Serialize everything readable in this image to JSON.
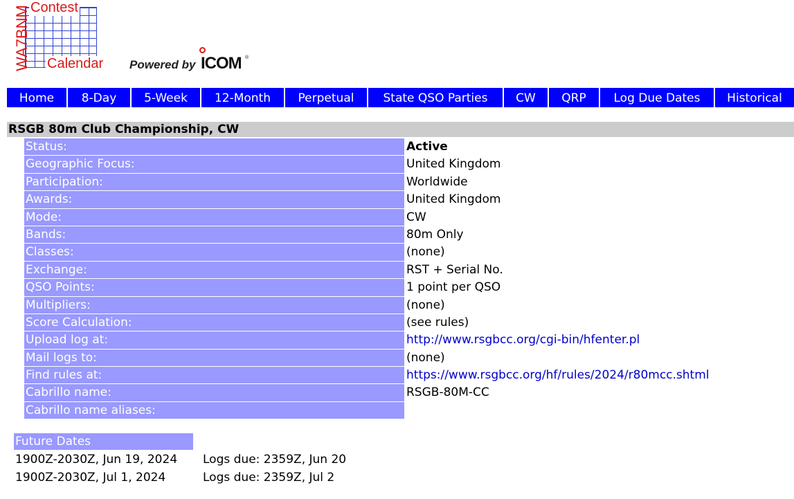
{
  "logo": {
    "vertical": "WA7BNM",
    "top": "Contest",
    "bottom": "Calendar",
    "powered_by": "Powered by",
    "brand": "ICOM",
    "tm": "®"
  },
  "nav": [
    "Home",
    "8-Day",
    "5-Week",
    "12-Month",
    "Perpetual",
    "State QSO Parties",
    "CW",
    "QRP",
    "Log Due Dates",
    "Historical"
  ],
  "contest": {
    "title": "RSGB 80m Club Championship, CW",
    "fields": [
      {
        "label": "Status:",
        "value": "Active"
      },
      {
        "label": "Geographic Focus:",
        "value": "United Kingdom"
      },
      {
        "label": "Participation:",
        "value": "Worldwide"
      },
      {
        "label": "Awards:",
        "value": "United Kingdom"
      },
      {
        "label": "Mode:",
        "value": "CW"
      },
      {
        "label": "Bands:",
        "value": "80m Only"
      },
      {
        "label": "Classes:",
        "value": "(none)"
      },
      {
        "label": "Exchange:",
        "value": "RST + Serial No."
      },
      {
        "label": "QSO Points:",
        "value": "1 point per QSO"
      },
      {
        "label": "Multipliers:",
        "value": "(none)"
      },
      {
        "label": "Score Calculation:",
        "value": "(see rules)"
      },
      {
        "label": "Upload log at:",
        "value": "http://www.rsgbcc.org/cgi-bin/hfenter.pl"
      },
      {
        "label": "Mail logs to:",
        "value": "(none)"
      },
      {
        "label": "Find rules at:",
        "value": "https://www.rsgbcc.org/hf/rules/2024/r80mcc.shtml"
      },
      {
        "label": "Cabrillo name:",
        "value": "RSGB-80M-CC"
      },
      {
        "label": "Cabrillo name aliases:",
        "value": ""
      }
    ]
  },
  "future": {
    "heading": "Future Dates",
    "rows": [
      {
        "date": "1900Z-2030Z, Jun 19, 2024",
        "due": "Logs due: 2359Z, Jun 20"
      },
      {
        "date": "1900Z-2030Z, Jul 1, 2024",
        "due": "Logs due: 2359Z, Jul 2"
      }
    ]
  },
  "colors": {
    "nav": "#0000ff",
    "label_bg": "#9999ff",
    "title_bg": "#cccccc",
    "link": "#0000cc",
    "logo_red": "#d81a1a",
    "logo_blue": "#3344cc"
  }
}
